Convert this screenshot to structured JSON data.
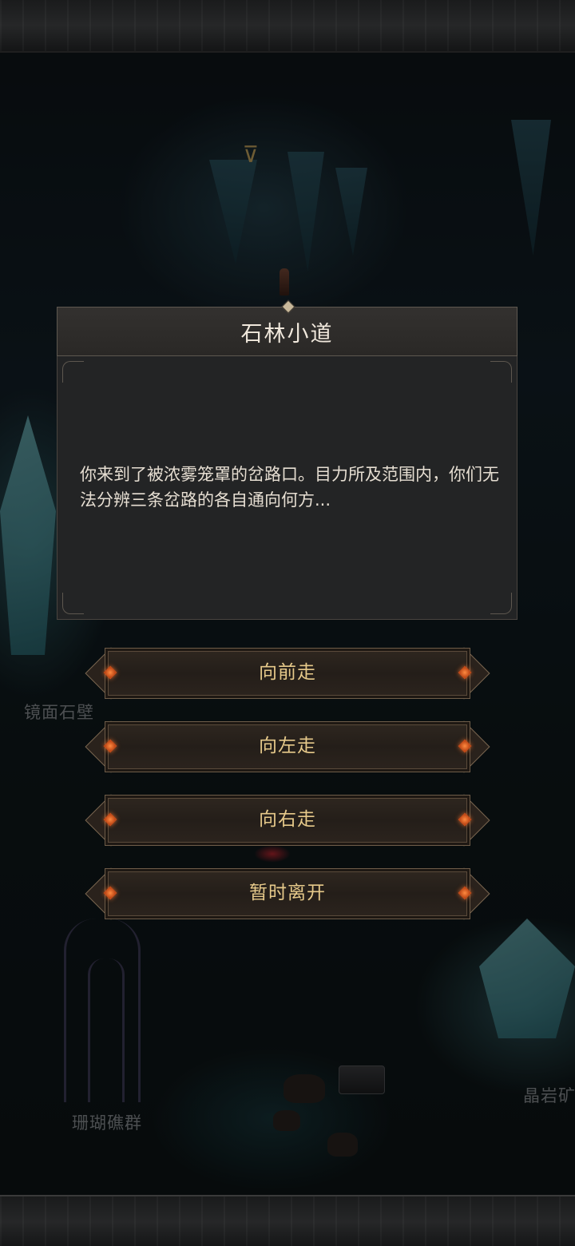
{
  "dialog": {
    "title": "石林小道",
    "body": "你来到了被浓雾笼罩的岔路口。目力所及范围内，你们无法分辨三条岔路的各自通向何方..."
  },
  "choices": [
    {
      "label": "向前走"
    },
    {
      "label": "向左走"
    },
    {
      "label": "向右走"
    },
    {
      "label": "暂时离开"
    }
  ],
  "map_labels": {
    "mirror_wall": "镜面石壁",
    "coral_reef": "珊瑚礁群",
    "crystal_mine": "晶岩矿"
  },
  "icons": {
    "location_marker": "location-marker-icon",
    "option_gem": "gem-icon"
  },
  "colors": {
    "choice_text": "#e6c98a",
    "pip": "#ff8a40",
    "title_text": "#f0e8dc"
  }
}
